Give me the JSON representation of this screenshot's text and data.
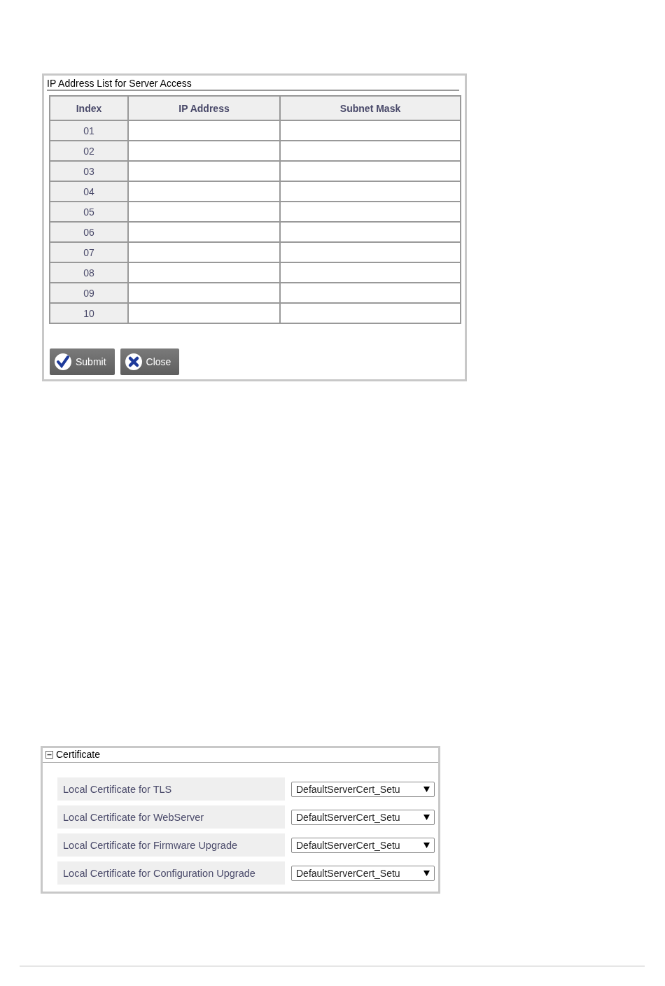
{
  "ip_list_panel": {
    "title": "IP Address List for Server Access",
    "table": {
      "columns": [
        "Index",
        "IP Address",
        "Subnet Mask"
      ],
      "rows": [
        {
          "index": "01"
        },
        {
          "index": "02"
        },
        {
          "index": "03"
        },
        {
          "index": "04"
        },
        {
          "index": "05"
        },
        {
          "index": "06"
        },
        {
          "index": "07"
        },
        {
          "index": "08"
        },
        {
          "index": "09"
        },
        {
          "index": "10"
        }
      ]
    },
    "buttons": [
      {
        "kind": "submit",
        "label": "Submit"
      },
      {
        "kind": "close",
        "label": "Close"
      }
    ]
  },
  "certificate_panel": {
    "title": "Certificate",
    "expanded": true,
    "fields": [
      {
        "label": "Local Certificate for TLS",
        "value": "DefaultServerCert_Setu"
      },
      {
        "label": "Local Certificate for WebServer",
        "value": "DefaultServerCert_Setu"
      },
      {
        "label": "Local Certificate for Firmware Upgrade",
        "value": "DefaultServerCert_Setu"
      },
      {
        "label": "Local Certificate for Configuration Upgrade",
        "value": "DefaultServerCert_Setu"
      }
    ]
  }
}
